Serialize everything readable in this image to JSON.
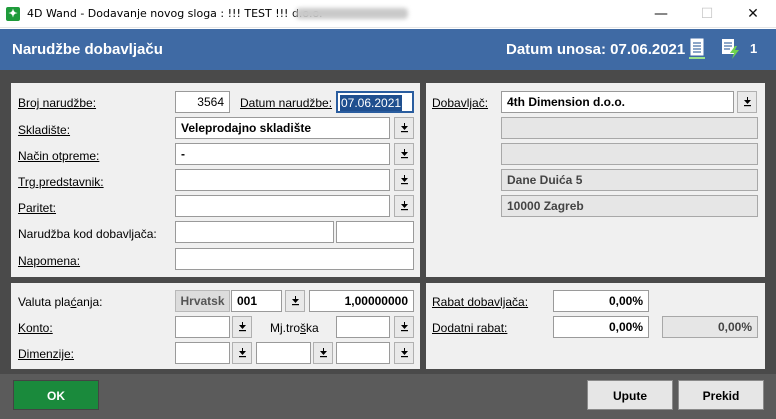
{
  "window": {
    "title": "4D Wand - Dodavanje novog sloga : !!! TEST !!! d.o.o.",
    "app_icon": "4d-wand-app-icon",
    "controls": {
      "minimize": "—",
      "maximize": "☐",
      "close": "✕"
    }
  },
  "header": {
    "title": "Narudžbe dobavljaču",
    "date_label": "Datum unosa: 07.06.2021",
    "icons": [
      "document-icon",
      "document-lightning-icon"
    ],
    "count": "1"
  },
  "left": {
    "broj_narudzbe_label": "Broj narudžbe:",
    "broj_narudzbe": "3564",
    "datum_narudzbe_label": "Datum narudžbe:",
    "datum_narudzbe": "07.06.2021",
    "skladiste_label": "Skladište:",
    "skladiste": "Veleprodajno skladište",
    "nacin_otpreme_label": "Način otpreme:",
    "nacin_otpreme": "-",
    "trg_predstavnik_label": "Trg.predstavnik:",
    "trg_predstavnik": "",
    "paritet_label": "Paritet:",
    "paritet": "",
    "narudzba_kod_dob_label": "Narudžba kod dobavljača:",
    "narudzba_kod_dob_1": "",
    "narudzba_kod_dob_2": "",
    "napomena_label": "Napomena:",
    "napomena": ""
  },
  "right": {
    "dobavljac_label": "Dobavljač:",
    "dobavljac": "4th Dimension d.o.o.",
    "address_line_1": "",
    "address_line_2": "",
    "street": "Dane Duića 5",
    "city": "10000 Zagreb"
  },
  "currency": {
    "valuta_label": "Valuta plaćanja:",
    "valuta_name": "Hrvatsk",
    "valuta_code": "001",
    "tecaj": "1,00000000",
    "konto_label": "Konto:",
    "konto": "",
    "mj_troska_label": "Mj.troška",
    "mj_troska": "",
    "dimenzije_label": "Dimenzije:",
    "dim_1": "",
    "dim_2": "",
    "dim_3": ""
  },
  "rabat": {
    "rabat_dob_label": "Rabat dobavljača:",
    "rabat_dob": "0,00%",
    "dodatni_label": "Dodatni rabat:",
    "dodatni": "0,00%",
    "ukupno": "0,00%"
  },
  "buttons": {
    "ok": "OK",
    "upute": "Upute",
    "prekid": "Prekid"
  }
}
